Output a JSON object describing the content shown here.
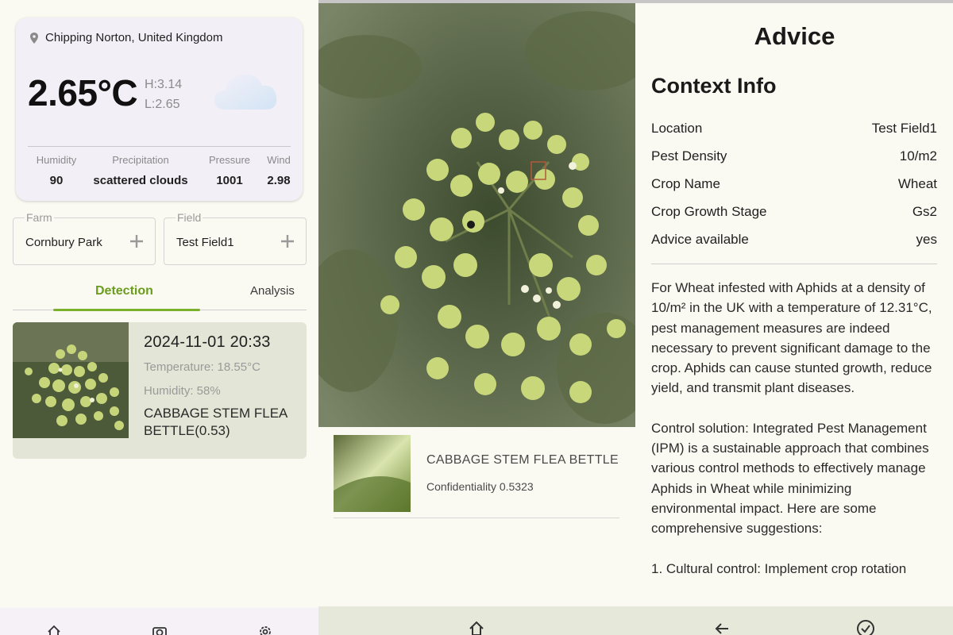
{
  "weather": {
    "location": "Chipping Norton, United Kingdom",
    "temperature": "2.65°C",
    "high": "H:3.14",
    "low": "L:2.65",
    "icon": "cloud-icon",
    "stats": [
      {
        "label": "Humidity",
        "value": "90"
      },
      {
        "label": "Precipitation",
        "value": "scattered clouds"
      },
      {
        "label": "Pressure",
        "value": "1001"
      },
      {
        "label": "Wind",
        "value": "2.98"
      }
    ]
  },
  "farm": {
    "caption": "Farm",
    "value": "Cornbury Park"
  },
  "field": {
    "caption": "Field",
    "value": "Test Field1"
  },
  "tabs": {
    "detection": "Detection",
    "analysis": "Analysis"
  },
  "result": {
    "time": "2024-11-01 20:33",
    "temperature": "Temperature:  18.55°C",
    "humidity": "Humidity:  58%",
    "pest": "CABBAGE STEM FLEA BETTLE(0.53)"
  },
  "detail": {
    "pest": "CABBAGE STEM FLEA BETTLE",
    "confidence": "Confidentiality 0.5323"
  },
  "advice": {
    "title": "Advice",
    "context_title": "Context Info",
    "context": [
      {
        "label": "Location",
        "value": "Test Field1"
      },
      {
        "label": "Pest Density",
        "value": "10/m2"
      },
      {
        "label": "Crop Name",
        "value": "Wheat"
      },
      {
        "label": "Crop Growth Stage",
        "value": "Gs2"
      },
      {
        "label": "Advice available",
        "value": "yes"
      }
    ],
    "paragraphs": [
      "For Wheat infested with Aphids at a density of 10/m² in the UK with a temperature of 12.31°C, pest management measures are indeed necessary to prevent significant damage to the crop. Aphids can cause stunted growth, reduce yield, and transmit plant diseases.",
      "Control solution: Integrated Pest Management (IPM) is a sustainable approach that combines various control methods to effectively manage Aphids in Wheat while minimizing environmental impact. Here are some comprehensive suggestions:",
      "1. Cultural control: Implement crop rotation"
    ]
  },
  "colors": {
    "accent": "#7bb02b",
    "card": "#f2eff6",
    "result_card": "#e3e5d6",
    "nav": "#e6e8d9"
  }
}
